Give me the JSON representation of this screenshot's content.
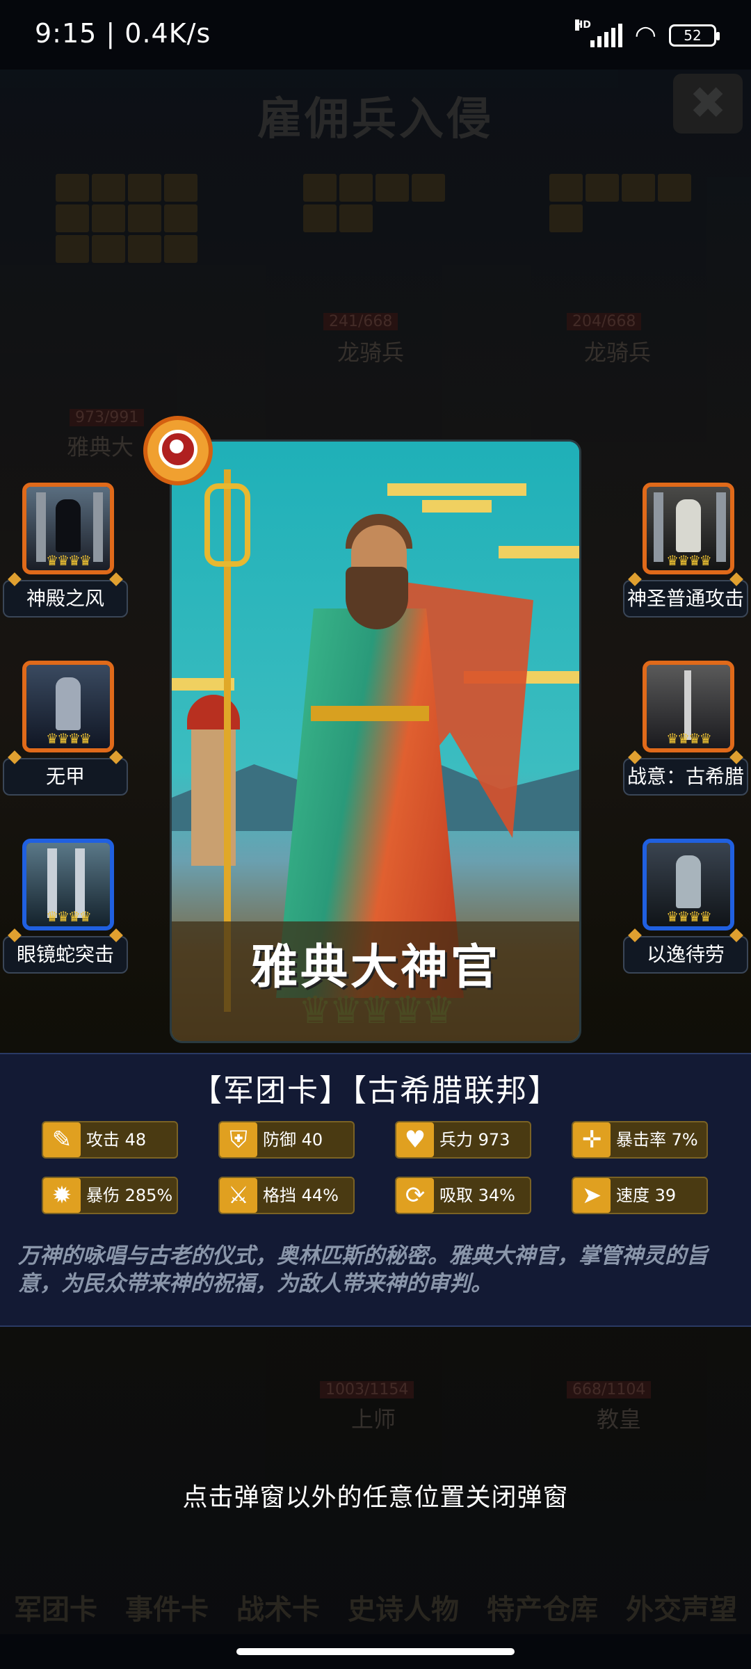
{
  "status_bar": {
    "time_speed": "9:15 | 0.4K/s",
    "battery": "52",
    "network": "HD"
  },
  "background": {
    "title": "雇佣兵入侵",
    "close_label": "✖",
    "troops_top": [
      {
        "name": "龙骑兵",
        "hp": "241/668"
      },
      {
        "name": "龙骑兵",
        "hp": "204/668"
      },
      {
        "name": "雅典大",
        "hp": "973/991"
      }
    ],
    "troops_bottom": [
      {
        "name": "上师",
        "hp": "1003/1154"
      },
      {
        "name": "教皇",
        "hp": "668/1104"
      }
    ],
    "bottom_nav": [
      "军团卡",
      "事件卡",
      "战术卡",
      "史诗人物",
      "特产仓库",
      "外交声望"
    ]
  },
  "skills_left": [
    {
      "label": "神殿之风",
      "crowns": "♛♛♛♛"
    },
    {
      "label": "无甲",
      "crowns": "♛♛♛♛"
    },
    {
      "label": "眼镜蛇突击",
      "crowns": "♛♛♛♛"
    }
  ],
  "skills_right": [
    {
      "label": "神圣普通攻击",
      "crowns": "♛♛♛♛"
    },
    {
      "label": "战意：古希腊",
      "crowns": "♛♛♛♛"
    },
    {
      "label": "以逸待劳",
      "crowns": "♛♛♛♛"
    }
  ],
  "card": {
    "name": "雅典大神官",
    "stars": "♛♛♛♛♛"
  },
  "info": {
    "header": "【军团卡】【古希腊联邦】",
    "stats": [
      {
        "icon": "✎",
        "text": "攻击 48"
      },
      {
        "icon": "⛨",
        "text": "防御 40"
      },
      {
        "icon": "♥",
        "text": "兵力 973"
      },
      {
        "icon": "✛",
        "text": "暴击率 7%"
      },
      {
        "icon": "✹",
        "text": "暴伤 285%"
      },
      {
        "icon": "⚔",
        "text": "格挡 44%"
      },
      {
        "icon": "⟳",
        "text": "吸取 34%"
      },
      {
        "icon": "➤",
        "text": "速度 39"
      }
    ],
    "description": "万神的咏唱与古老的仪式，奥林匹斯的秘密。雅典大神官，掌管神灵的旨意，为民众带来神的祝福，为敌人带来神的审判。"
  },
  "hint": "点击弹窗以外的任意位置关闭弹窗",
  "colors": {
    "panel": "#131a34",
    "stat_bg": "#4a3a12",
    "stat_icon": "#e0a020",
    "skill_border_orange": "#e06a1a",
    "skill_border_blue": "#2060e0"
  }
}
